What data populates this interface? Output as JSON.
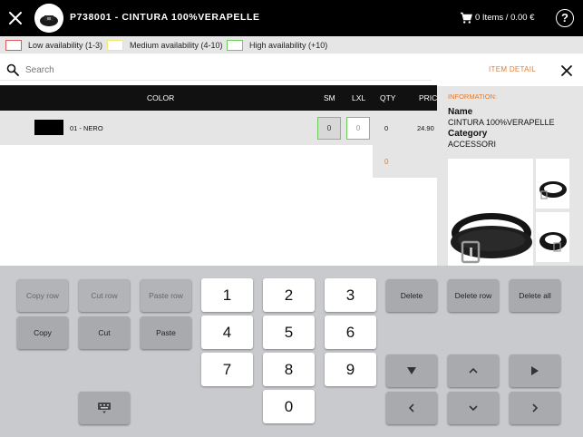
{
  "header": {
    "title": "P738001 - CINTURA 100%VERAPELLE",
    "cart_text": "0 Items / 0.00 €",
    "help_label": "?"
  },
  "legend": [
    {
      "label": "Low availability (1-3)",
      "color": "#e05a5a"
    },
    {
      "label": "Medium availability (4-10)",
      "color": "#f0ea78"
    },
    {
      "label": "High availability (+10)",
      "color": "#6dcd5a"
    }
  ],
  "search": {
    "placeholder": "Search"
  },
  "grid": {
    "headers": {
      "color": "COLOR",
      "sm": "SM",
      "lxl": "LXL",
      "qty": "QTY",
      "price": "PRICE"
    },
    "rows": [
      {
        "color_name": "01 - NERO",
        "swatch": "#000000",
        "sm": "0",
        "lxl": "0",
        "qty": "0",
        "price": "24.90"
      }
    ],
    "total_qty": "0"
  },
  "detail": {
    "title": "ITEM DETAIL",
    "info_label": "INFORMATION:",
    "name_label": "Name",
    "name_value": "CINTURA 100%VERAPELLE",
    "category_label": "Category",
    "category_value": "ACCESSORI"
  },
  "keypad": {
    "copy_row": "Copy row",
    "cut_row": "Cut row",
    "paste_row": "Paste row",
    "copy": "Copy",
    "cut": "Cut",
    "paste": "Paste",
    "delete": "Delete",
    "delete_row": "Delete row",
    "delete_all": "Delete all",
    "digits": [
      "1",
      "2",
      "3",
      "4",
      "5",
      "6",
      "7",
      "8",
      "9",
      "0"
    ]
  },
  "icons": {
    "close": "close-icon",
    "cart": "cart-icon",
    "help": "help-icon",
    "search": "search-icon",
    "keyboard": "keyboard-icon"
  },
  "colors": {
    "accent": "#e07b2e",
    "topbar": "#000000",
    "keypad_bg": "#c9cacd"
  }
}
